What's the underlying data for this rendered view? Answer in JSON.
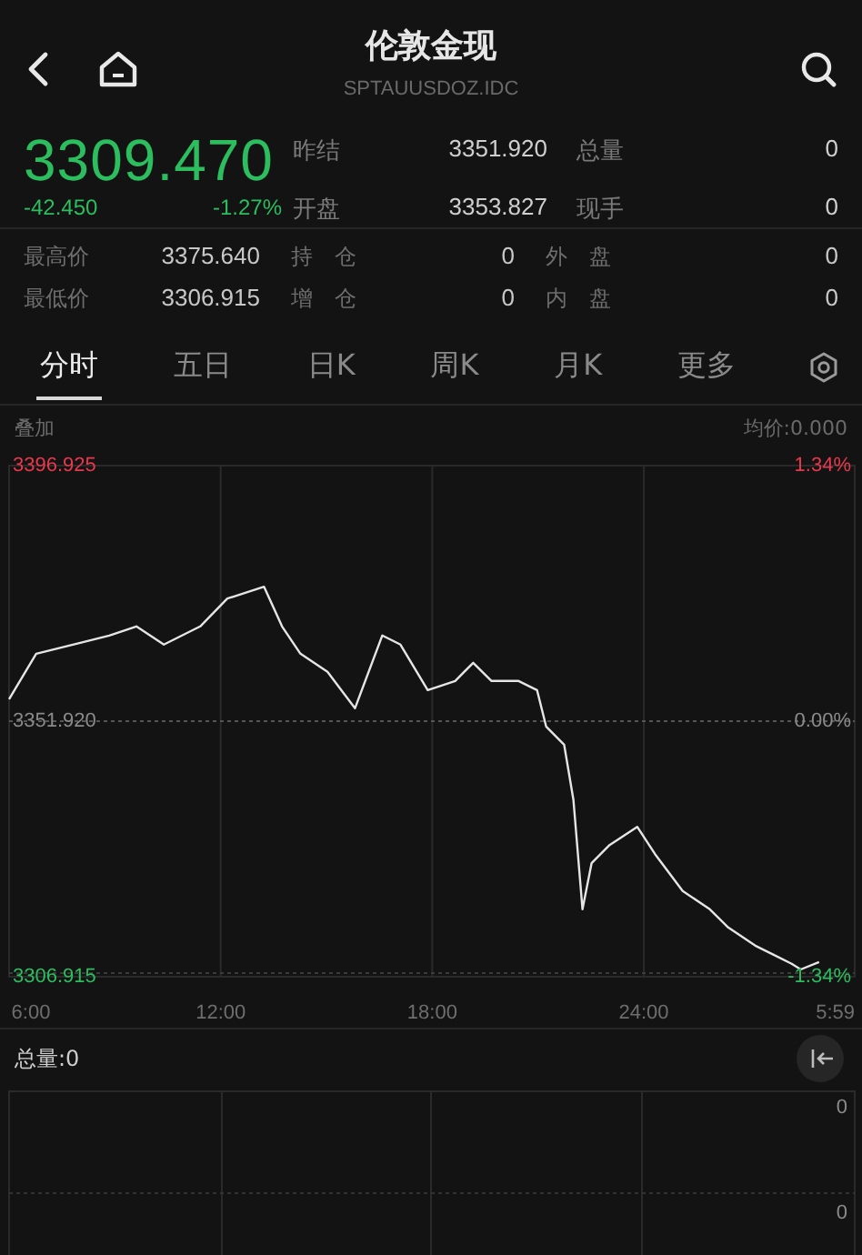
{
  "header": {
    "title": "伦敦金现",
    "code": "SPTAUUSDOZ.IDC"
  },
  "quote": {
    "price": "3309.470",
    "change": "-42.450",
    "change_pct": "-1.27%",
    "stats": [
      {
        "label": "昨结",
        "value": "3351.920"
      },
      {
        "label": "总量",
        "value": "0"
      },
      {
        "label": "开盘",
        "value": "3353.827"
      },
      {
        "label": "现手",
        "value": "0"
      }
    ]
  },
  "details": [
    {
      "label": "最高价",
      "value": "3375.640"
    },
    {
      "label": "持　仓",
      "value": "0"
    },
    {
      "label": "外　盘",
      "value": "0"
    },
    {
      "label": "最低价",
      "value": "3306.915"
    },
    {
      "label": "增　仓",
      "value": "0"
    },
    {
      "label": "内　盘",
      "value": "0"
    }
  ],
  "tabs": [
    {
      "label": "分时",
      "selected": true
    },
    {
      "label": "五日",
      "selected": false
    },
    {
      "label": "日K",
      "selected": false
    },
    {
      "label": "周K",
      "selected": false
    },
    {
      "label": "月K",
      "selected": false
    },
    {
      "label": "更多",
      "selected": false
    }
  ],
  "chart": {
    "overlay_label": "叠加",
    "avg_price": "均价:0.000",
    "percent_labels": [
      "1.34%",
      "0.00%",
      "-1.34%"
    ],
    "end_time_label": "5:59",
    "chart_data": {
      "type": "line",
      "x": [
        6.0,
        6.77,
        7.81,
        8.84,
        9.61,
        10.39,
        11.42,
        12.19,
        13.23,
        13.74,
        14.26,
        15.03,
        15.81,
        16.58,
        17.1,
        17.87,
        18.65,
        19.16,
        19.68,
        20.45,
        20.97,
        21.23,
        21.74,
        22.0,
        22.26,
        22.52,
        23.03,
        23.81,
        24.32,
        25.1,
        25.87,
        26.39,
        27.16,
        27.68,
        28.19,
        28.45,
        28.97
      ],
      "series": [
        {
          "color": "#e6e6e6",
          "values": [
            3355.8,
            3363.8,
            3365.4,
            3367.0,
            3368.6,
            3365.4,
            3368.6,
            3373.5,
            3375.6,
            3368.6,
            3363.8,
            3360.6,
            3354.2,
            3367.0,
            3365.4,
            3357.4,
            3359.0,
            3362.2,
            3359.0,
            3359.0,
            3357.4,
            3351.0,
            3347.8,
            3338.1,
            3318.8,
            3326.9,
            3330.1,
            3333.3,
            3328.5,
            3322.0,
            3318.8,
            3315.6,
            3312.4,
            3310.8,
            3309.2,
            3308.2,
            3309.5
          ]
        }
      ],
      "xlim": [
        6,
        29.98
      ],
      "ylim": [
        3306.915,
        3396.925
      ],
      "grid": true,
      "ref_lines": [
        {
          "axis": "y",
          "value": 3351.92
        }
      ],
      "xticks": [
        {
          "value": 6,
          "label": "6:00"
        },
        {
          "value": 12,
          "label": "12:00"
        },
        {
          "value": 18,
          "label": "18:00"
        },
        {
          "value": 24,
          "label": "24:00"
        }
      ],
      "yticks": [
        {
          "value": 3396.925,
          "label": "3396.925"
        },
        {
          "value": 3351.92,
          "label": "3351.920"
        },
        {
          "value": 3306.915,
          "label": "3306.915"
        }
      ]
    }
  },
  "volume": {
    "label": "总量:0",
    "axis_labels": [
      "0",
      "0"
    ]
  }
}
